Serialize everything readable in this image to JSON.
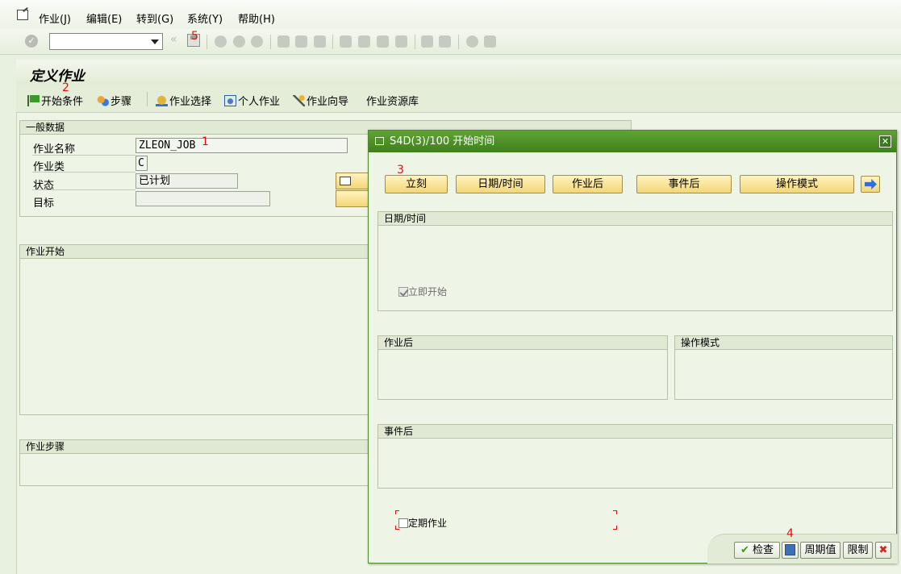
{
  "menu": {
    "items": [
      "作业(J)",
      "编辑(E)",
      "转到(G)",
      "系统(Y)",
      "帮助(H)"
    ]
  },
  "toolbar": {
    "command_value": "",
    "icons": [
      "check-icon",
      "command-field",
      "back-icon",
      "save-icon",
      "back-green-icon",
      "exit-icon",
      "cancel-icon",
      "print-icon",
      "find-icon",
      "find-next-icon",
      "first-page-icon",
      "prev-page-icon",
      "next-page-icon",
      "last-page-icon",
      "new-session-icon",
      "shortcut-icon",
      "help-icon",
      "customize-icon"
    ]
  },
  "screen": {
    "title": "定义作业",
    "app_toolbar": [
      "开始条件",
      "步骤",
      "作业选择",
      "个人作业",
      "作业向导",
      "作业资源库"
    ]
  },
  "general": {
    "header": "一般数据",
    "job_name_label": "作业名称",
    "job_name_value": "ZLEON_JOB",
    "job_class_label": "作业类",
    "job_class_value": "C",
    "status_label": "状态",
    "status_value": "已计划",
    "target_label": "目标",
    "target_value": ""
  },
  "job_start": {
    "header": "作业开始"
  },
  "job_steps": {
    "header": "作业步骤"
  },
  "annotations": [
    "1",
    "2",
    "3",
    "4",
    "5"
  ],
  "dialog": {
    "title": "S4D(3)/100 开始时间",
    "buttons": [
      "立刻",
      "日期/时间",
      "作业后",
      "事件后",
      "操作模式"
    ],
    "date_time_header": "日期/时间",
    "immediate_start_label": "立即开始",
    "immediate_start_checked": true,
    "after_job_header": "作业后",
    "op_mode_header": "操作模式",
    "after_event_header": "事件后",
    "periodic_label": "定期作业",
    "periodic_checked": false,
    "footer_buttons": {
      "check": "检查",
      "period": "周期值",
      "restrict": "限制"
    }
  },
  "colors": {
    "dialog_header": "#4e8e26",
    "button_yellow": "#f7de86",
    "annotation_red": "#e01010",
    "background": "#eef4e6"
  }
}
